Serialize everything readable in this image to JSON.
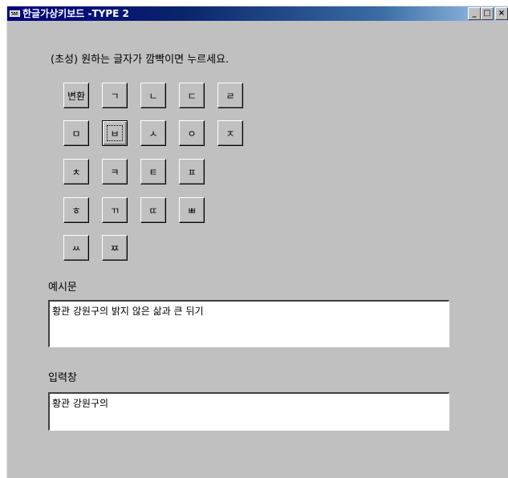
{
  "window": {
    "title": "한글가상키보드 -TYPE 2",
    "minimize_label": "_",
    "maximize_label": "□",
    "close_label": "×"
  },
  "instruction": "(초성) 원하는 글자가 깜빡이면 누르세요.",
  "keys": [
    "변환",
    "ㄱ",
    "ㄴ",
    "ㄷ",
    "ㄹ",
    "ㅁ",
    "ㅂ",
    "ㅅ",
    "ㅇ",
    "ㅈ",
    "ㅊ",
    "ㅋ",
    "ㅌ",
    "ㅍ",
    "ㅎ",
    "ㄲ",
    "ㄸ",
    "ㅃ",
    "ㅆ",
    "ㅉ"
  ],
  "example": {
    "label": "예시문",
    "text": "황관 강원구의 밝지 않은 삶과 큰 뒤기"
  },
  "input": {
    "label": "입력창",
    "text": "황관 강원구의"
  },
  "colors": {
    "window_bg": "#c0c0c0",
    "titlebar": "#000080"
  }
}
